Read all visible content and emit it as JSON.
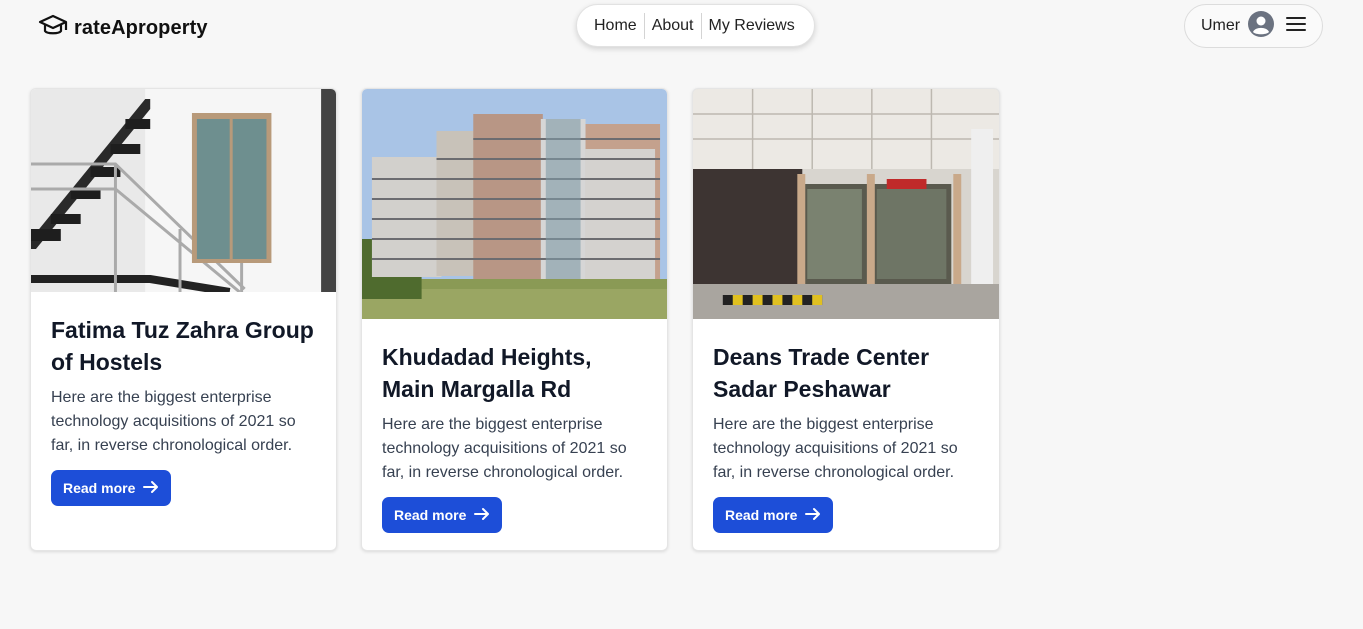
{
  "brand": {
    "name": "rateAproperty",
    "logo_icon": "graduation-cap-icon"
  },
  "nav": {
    "items": [
      "Home",
      "About",
      "My Reviews"
    ]
  },
  "user": {
    "name": "Umer",
    "avatar_icon": "user-avatar-icon",
    "menu_icon": "hamburger-menu-icon"
  },
  "cards": [
    {
      "title": "Fatima Tuz Zahra Group of Hostels",
      "description": "Here are the biggest enterprise technology acquisitions of 2021 so far, in reverse chronological order.",
      "button_label": "Read more",
      "image": "hostel-staircase-photo"
    },
    {
      "title": "Khudadad Heights, Main Margalla Rd",
      "description": "Here are the biggest enterprise technology acquisitions of 2021 so far, in reverse chronological order.",
      "button_label": "Read more",
      "image": "high-rise-building-photo"
    },
    {
      "title": "Deans Trade Center Sadar Peshawar",
      "description": "Here are the biggest enterprise technology acquisitions of 2021 so far, in reverse chronological order.",
      "button_label": "Read more",
      "image": "trade-center-storefront-photo"
    }
  ],
  "colors": {
    "accent": "#1d4ed8",
    "background": "#f7f7f7"
  }
}
